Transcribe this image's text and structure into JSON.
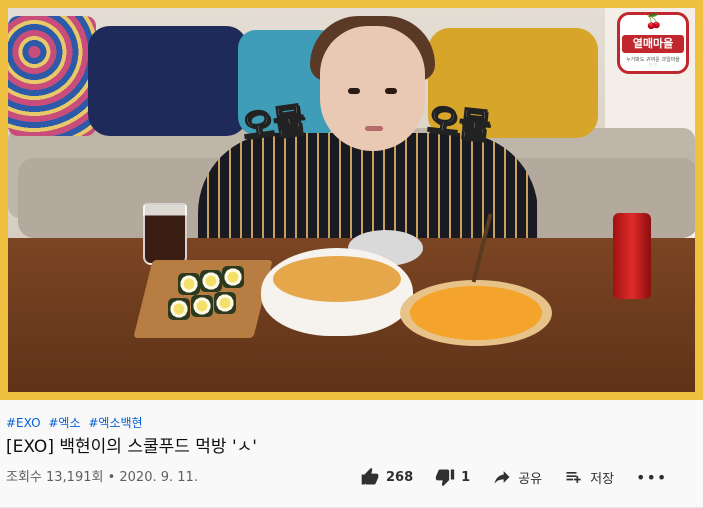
{
  "video": {
    "overlay_left": "오물",
    "overlay_right": "오물",
    "channel_logo_text": "열매마을",
    "channel_logo_subtext": "누가봐도 귀여운 과일마을 ♡♡"
  },
  "meta": {
    "hashtags": [
      "#EXO",
      "#엑소",
      "#엑소백현"
    ],
    "title": "[EXO] 백현이의 스쿨푸드 먹방 'ㅅ'",
    "views": "조회수 13,191회 • 2020. 9. 11.",
    "actions": {
      "like_count": "268",
      "dislike_count": "1",
      "share_label": "공유",
      "save_label": "저장",
      "more_label": "•••"
    }
  },
  "icons": {
    "like": "thumbs-up-icon",
    "dislike": "thumbs-down-icon",
    "share": "share-arrow-icon",
    "save": "playlist-add-icon",
    "more": "more-horizontal-icon"
  },
  "colors": {
    "frame_border": "#f0c040",
    "hashtag": "#065fd4",
    "logo_red": "#c0282d"
  }
}
